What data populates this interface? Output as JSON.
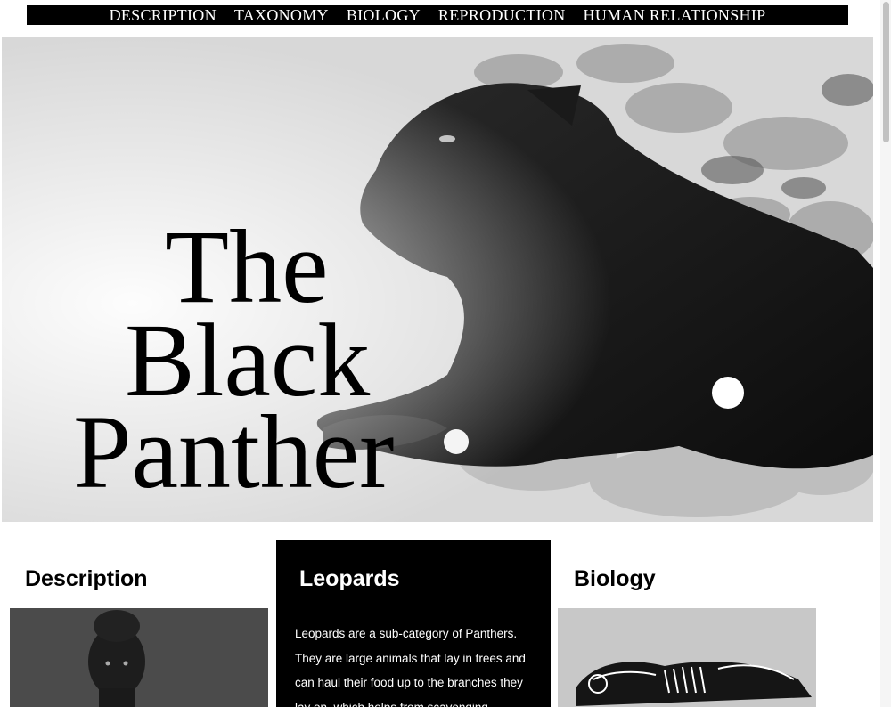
{
  "nav": {
    "items": [
      {
        "label": "DESCRIPTION"
      },
      {
        "label": "TAXONOMY"
      },
      {
        "label": "BIOLOGY"
      },
      {
        "label": "REPRODUCTION"
      },
      {
        "label": "HUMAN RELATIONSHIP"
      }
    ]
  },
  "hero": {
    "title_line1": "The",
    "title_line2": "Black",
    "title_line3": "Panther"
  },
  "cards": {
    "description": {
      "heading": "Description"
    },
    "leopards": {
      "heading": "Leopards",
      "text": "Leopards are a sub-category of Panthers. They are large animals that lay in trees and can haul their food up to the branches they lay on, which helps from scavenging"
    },
    "biology": {
      "heading": "Biology"
    }
  }
}
